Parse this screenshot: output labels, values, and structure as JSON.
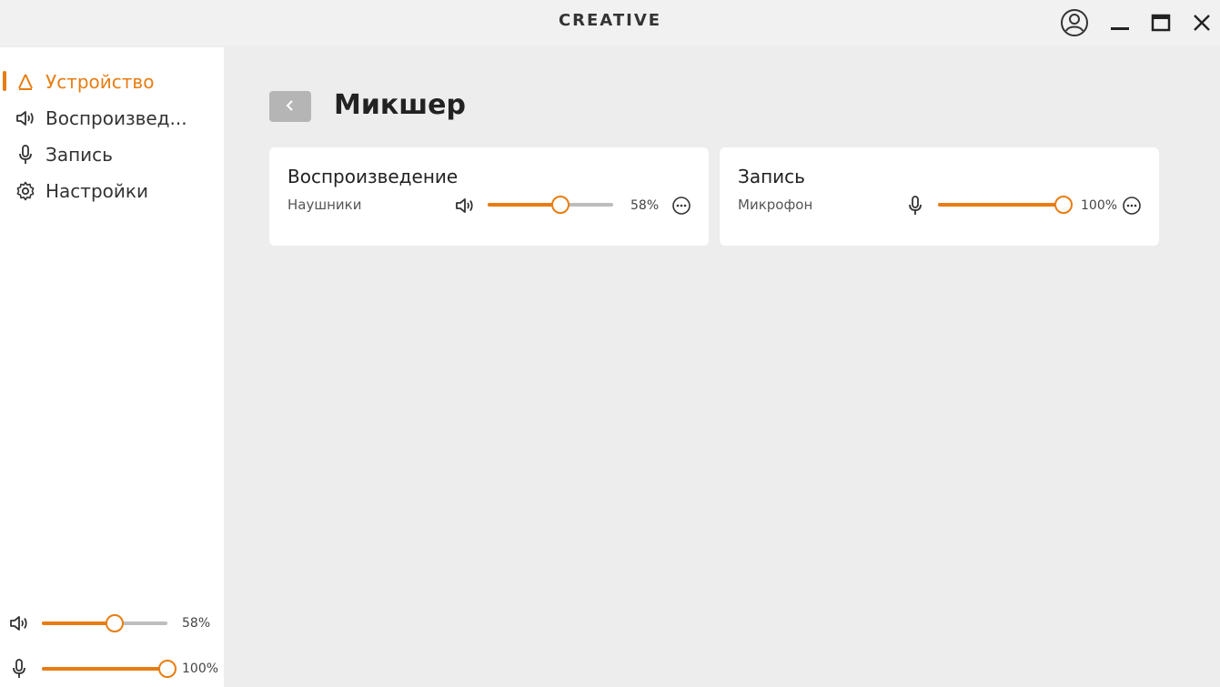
{
  "app": {
    "title": "CREATIVE"
  },
  "window_controls": {
    "account": "account-icon",
    "minimize": "minimize-icon",
    "maximize": "maximize-icon",
    "close": "close-icon"
  },
  "sidebar": {
    "items": [
      {
        "label": "Устройство",
        "icon": "device-icon",
        "active": true
      },
      {
        "label": "Воспроизвед...",
        "icon": "speaker-icon",
        "active": false
      },
      {
        "label": "Запись",
        "icon": "microphone-icon",
        "active": false
      },
      {
        "label": "Настройки",
        "icon": "gear-icon",
        "active": false
      }
    ],
    "quick_controls": [
      {
        "icon": "speaker-icon",
        "value": 58,
        "value_text": "58%"
      },
      {
        "icon": "microphone-icon",
        "value": 100,
        "value_text": "100%"
      }
    ]
  },
  "main": {
    "title": "Микшер",
    "cards": [
      {
        "title": "Воспроизведение",
        "device": "Наушники",
        "icon": "speaker-icon",
        "value": 58,
        "value_text": "58%"
      },
      {
        "title": "Запись",
        "device": "Микрофон",
        "icon": "microphone-icon",
        "value": 100,
        "value_text": "100%"
      }
    ]
  },
  "colors": {
    "accent": "#e87c12",
    "sidebar_bg": "#ffffff",
    "content_bg": "#ededed",
    "track": "#bdbdbd"
  }
}
